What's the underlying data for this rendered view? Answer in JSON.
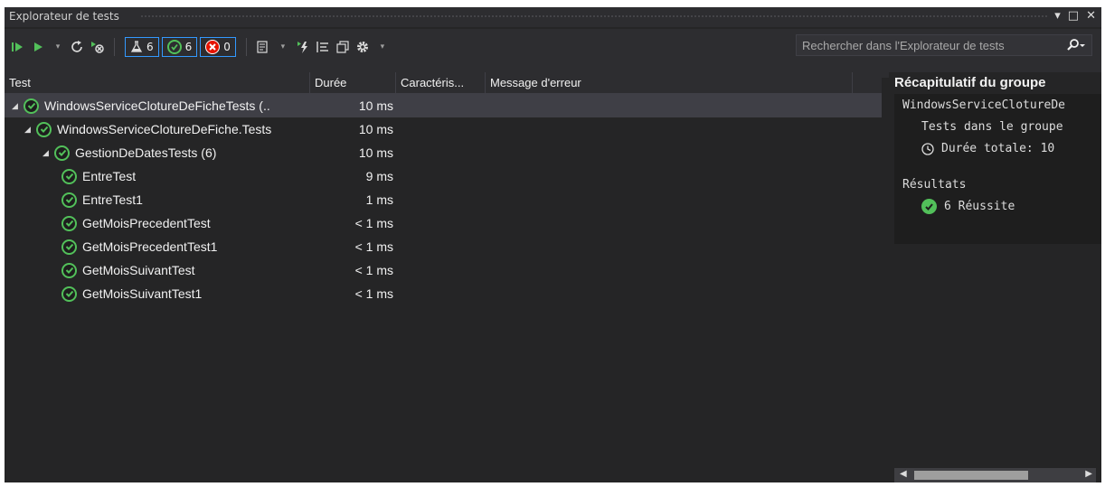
{
  "window": {
    "title": "Explorateur de tests",
    "controls": [
      "▾",
      "□",
      "✕"
    ]
  },
  "toolbar": {
    "filter_total": "6",
    "filter_passed": "6",
    "filter_failed": "0",
    "search_placeholder": "Rechercher dans l'Explorateur de tests"
  },
  "table": {
    "columns": [
      "Test",
      "Durée",
      "Caractéris...",
      "Message d'erreur"
    ],
    "rows": [
      {
        "name": "WindowsServiceClotureDeFicheTests (..",
        "duration": "10 ms",
        "level": 0,
        "expandable": true,
        "selected": true
      },
      {
        "name": "WindowsServiceClotureDeFiche.Tests",
        "duration": "10 ms",
        "level": 1,
        "expandable": true,
        "selected": false
      },
      {
        "name": "GestionDeDatesTests (6)",
        "duration": "10 ms",
        "level": 2,
        "expandable": true,
        "selected": false
      },
      {
        "name": "EntreTest",
        "duration": "9 ms",
        "level": 3,
        "expandable": false,
        "selected": false
      },
      {
        "name": "EntreTest1",
        "duration": "1 ms",
        "level": 3,
        "expandable": false,
        "selected": false
      },
      {
        "name": "GetMoisPrecedentTest",
        "duration": "< 1 ms",
        "level": 3,
        "expandable": false,
        "selected": false
      },
      {
        "name": "GetMoisPrecedentTest1",
        "duration": "< 1 ms",
        "level": 3,
        "expandable": false,
        "selected": false
      },
      {
        "name": "GetMoisSuivantTest",
        "duration": "< 1 ms",
        "level": 3,
        "expandable": false,
        "selected": false
      },
      {
        "name": "GetMoisSuivantTest1",
        "duration": "< 1 ms",
        "level": 3,
        "expandable": false,
        "selected": false
      }
    ]
  },
  "summary": {
    "header": "Récapitulatif du groupe",
    "group_name": "WindowsServiceClotureDe",
    "tests_in_group": "Tests dans le groupe",
    "total_duration": "Durée totale: 10 ",
    "results_label": "Résultats",
    "passed": "6 Réussite"
  },
  "colors": {
    "background": "#252526",
    "accent": "#3399ff",
    "pass": "#52c05a",
    "fail": "#e51400",
    "run": "#52c05a"
  }
}
